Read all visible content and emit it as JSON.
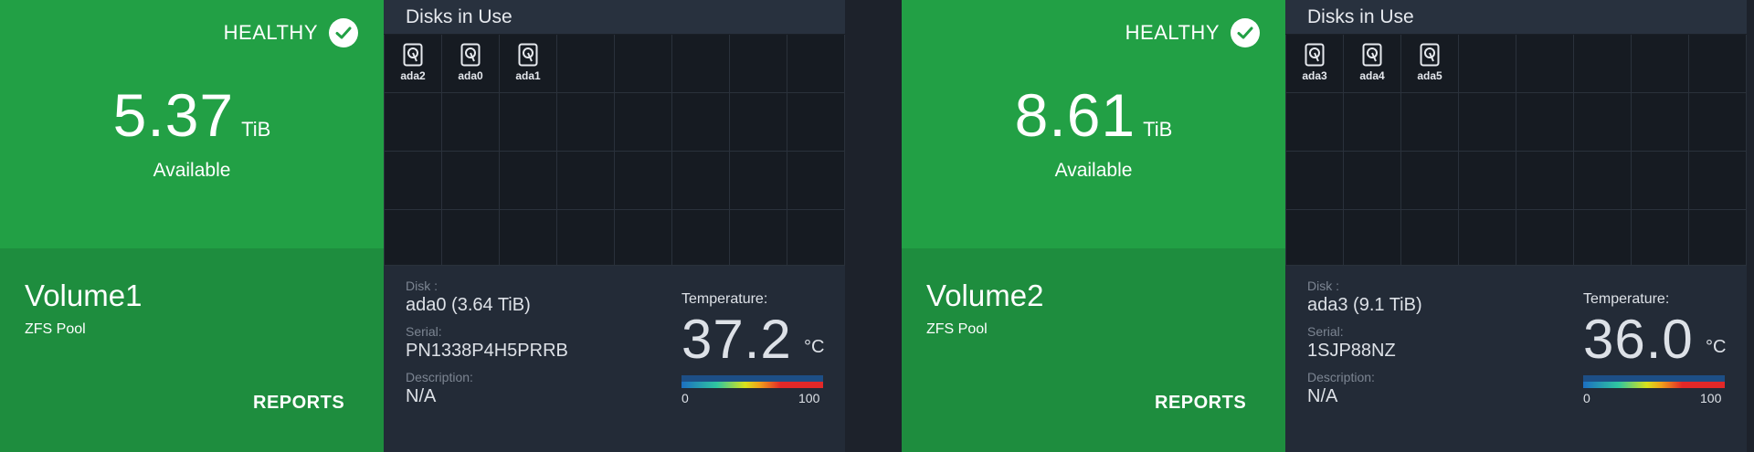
{
  "volumes": [
    {
      "status": "HEALTHY",
      "available_value": "5.37",
      "available_unit": "TiB",
      "available_label": "Available",
      "name": "Volume1",
      "type": "ZFS Pool",
      "reports_label": "REPORTS",
      "disks_title": "Disks in Use",
      "disks": [
        "ada2",
        "ada0",
        "ada1"
      ],
      "disk_label": "Disk :",
      "disk_value": "ada0 (3.64 TiB)",
      "serial_label": "Serial:",
      "serial_value": "PN1338P4H5PRRB",
      "description_label": "Description:",
      "description_value": "N/A",
      "temperature_label": "Temperature:",
      "temperature_value": "37.2",
      "temperature_unit": "°C",
      "temperature_min": "0",
      "temperature_max": "100"
    },
    {
      "status": "HEALTHY",
      "available_value": "8.61",
      "available_unit": "TiB",
      "available_label": "Available",
      "name": "Volume2",
      "type": "ZFS Pool",
      "reports_label": "REPORTS",
      "disks_title": "Disks in Use",
      "disks": [
        "ada3",
        "ada4",
        "ada5"
      ],
      "disk_label": "Disk :",
      "disk_value": "ada3 (9.1 TiB)",
      "serial_label": "Serial:",
      "serial_value": "1SJP88NZ",
      "description_label": "Description:",
      "description_value": "N/A",
      "temperature_label": "Temperature:",
      "temperature_value": "36.0",
      "temperature_unit": "°C",
      "temperature_min": "0",
      "temperature_max": "100"
    }
  ],
  "icons": {
    "status": "check-circle-icon",
    "disk": "hard-drive-icon"
  },
  "colors": {
    "healthy_green": "#22a045",
    "healthy_green_dark": "#1e8d3e",
    "panel_dark": "#222a36"
  }
}
